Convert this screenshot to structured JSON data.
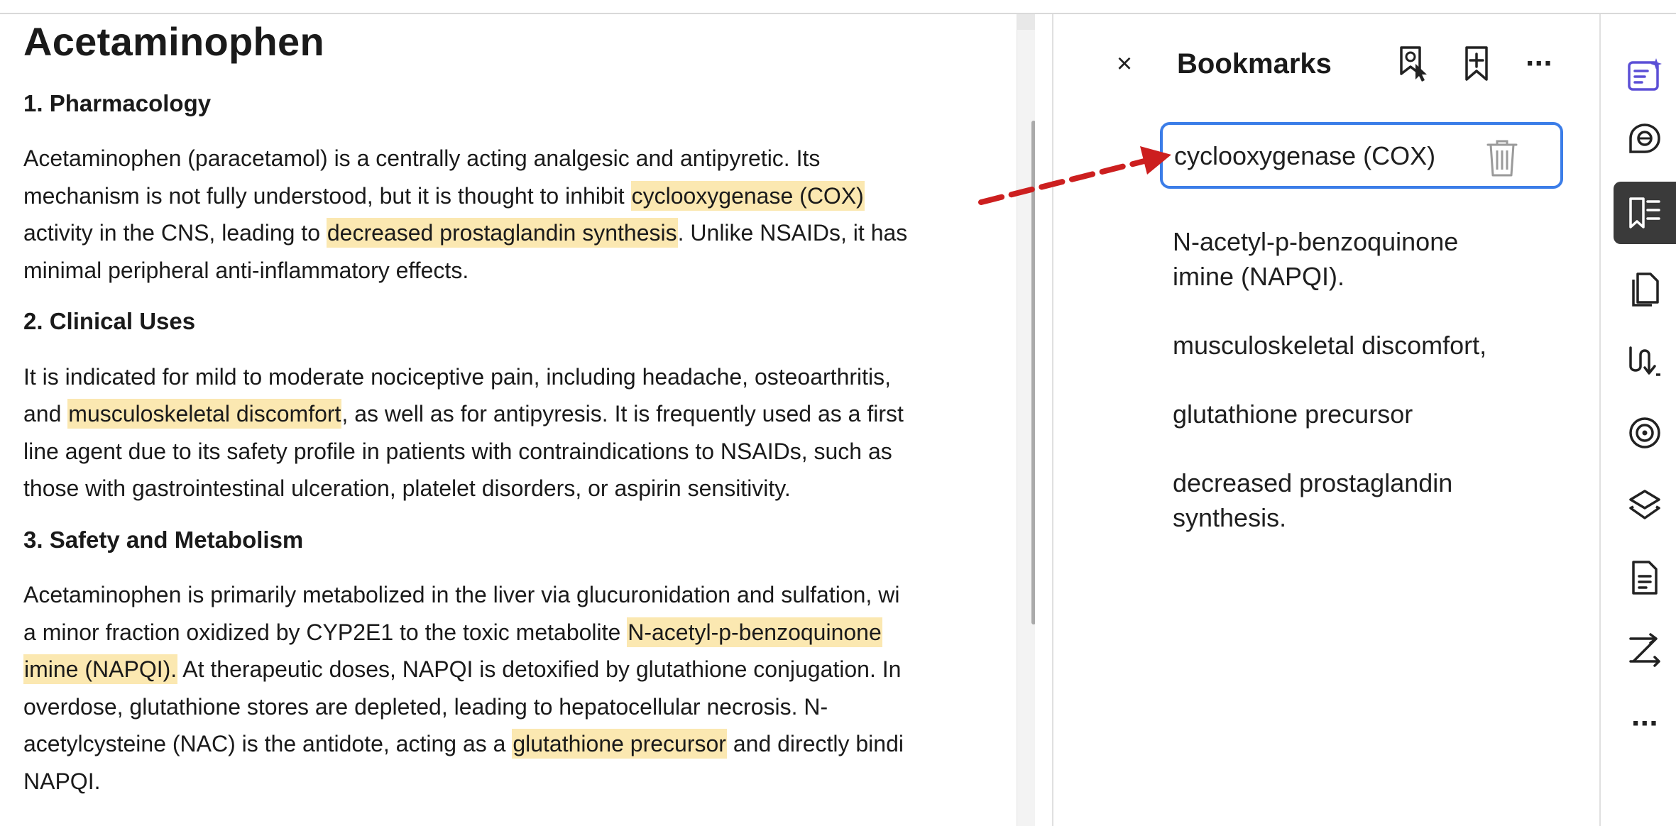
{
  "document": {
    "title": "Acetaminophen",
    "sections": [
      {
        "heading": "1. Pharmacology",
        "lines": [
          [
            "Acetaminophen (paracetamol) is a centrally acting analgesic and antipyretic. Its",
            "",
            ""
          ],
          [
            "mechanism is not fully understood, but it is thought to inhibit ",
            "cyclooxygenase (COX)",
            ""
          ],
          [
            "activity in the CNS, leading to ",
            "decreased prostaglandin synthesis",
            ". Unlike NSAIDs, it has"
          ],
          [
            "minimal peripheral anti-inflammatory effects.",
            "",
            ""
          ]
        ]
      },
      {
        "heading": "2. Clinical Uses",
        "lines": [
          [
            "It is indicated for mild to moderate nociceptive pain, including headache, osteoarthritis,",
            "",
            ""
          ],
          [
            "and ",
            "musculoskeletal discomfort",
            ", as well as for antipyresis. It is frequently used as a first"
          ],
          [
            "line agent due to its safety profile in patients with contraindications to NSAIDs, such as",
            "",
            ""
          ],
          [
            "those with gastrointestinal ulceration, platelet disorders, or aspirin sensitivity.",
            "",
            ""
          ]
        ]
      },
      {
        "heading": "3. Safety and Metabolism",
        "lines": [
          [
            "Acetaminophen is primarily metabolized in the liver via glucuronidation and sulfation, wi",
            "",
            ""
          ],
          [
            "a minor fraction oxidized by CYP2E1 to the toxic metabolite ",
            "N-acetyl-p-benzoquinone",
            ""
          ],
          [
            "",
            "imine (NAPQI).",
            " At therapeutic doses, NAPQI is detoxified by glutathione conjugation. In"
          ],
          [
            "overdose, glutathione stores are depleted, leading to hepatocellular necrosis. N-",
            "",
            ""
          ],
          [
            "acetylcysteine (NAC) is the antidote, acting as a ",
            "glutathione precursor",
            " and directly bindi"
          ],
          [
            "NAPQI.",
            "",
            ""
          ]
        ]
      }
    ]
  },
  "bookmarks_panel": {
    "close_icon": "×",
    "title": "Bookmarks",
    "items": [
      {
        "label": "cyclooxygenase (COX)",
        "selected": true
      },
      {
        "label": "N-acetyl-p-benzoquinone imine (NAPQI).",
        "line1": "N-acetyl-p-benzoquinone",
        "line2": "imine (NAPQI).",
        "selected": false
      },
      {
        "label": "musculoskeletal discomfort,",
        "selected": false
      },
      {
        "label": "glutathione precursor",
        "selected": false
      },
      {
        "label": "decreased prostaglandin synthesis.",
        "line1": "decreased prostaglandin",
        "line2": "synthesis.",
        "selected": false
      }
    ],
    "more_icon": "···"
  },
  "toolbar": {
    "more_icon": "···",
    "items": [
      "ai-assistant-icon",
      "comment-icon",
      "bookmarks-icon",
      "pages-icon",
      "signature-icon",
      "target-icon",
      "layers-icon",
      "document-icon",
      "compare-icon",
      "more-icon"
    ],
    "active": "bookmarks-icon"
  },
  "colors": {
    "highlight": "#fbe8b1",
    "selection_border": "#3b7de8",
    "arrow": "#cc1f1f",
    "active_tool_bg": "#3a3a3a",
    "ai_icon": "#5b4fd6"
  }
}
